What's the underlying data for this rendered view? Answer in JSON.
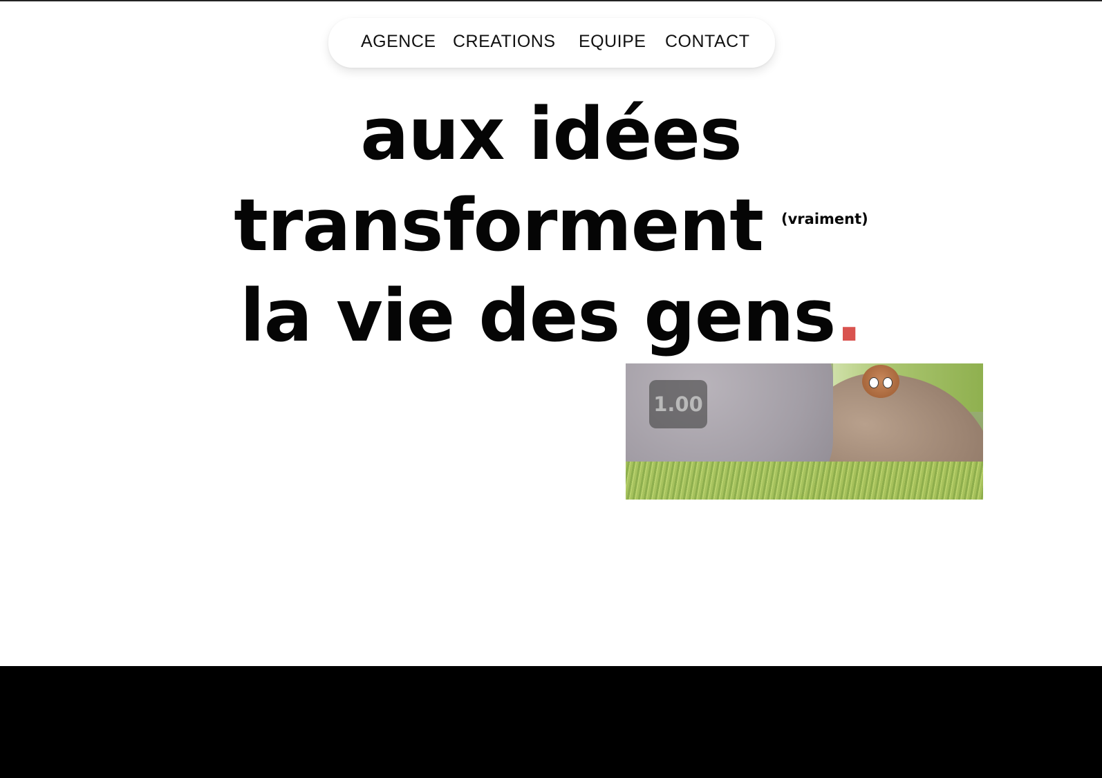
{
  "nav": {
    "items": [
      "AGENCE",
      "CREATIONS",
      "EQUIPE",
      "CONTACT"
    ]
  },
  "hero": {
    "line1": "aux idées",
    "line2": "transforment",
    "aside": "(vraiment)",
    "line3": "la vie des gens",
    "period": ".",
    "accent_color": "#d9534f"
  },
  "video": {
    "speed_label": "1.00"
  }
}
